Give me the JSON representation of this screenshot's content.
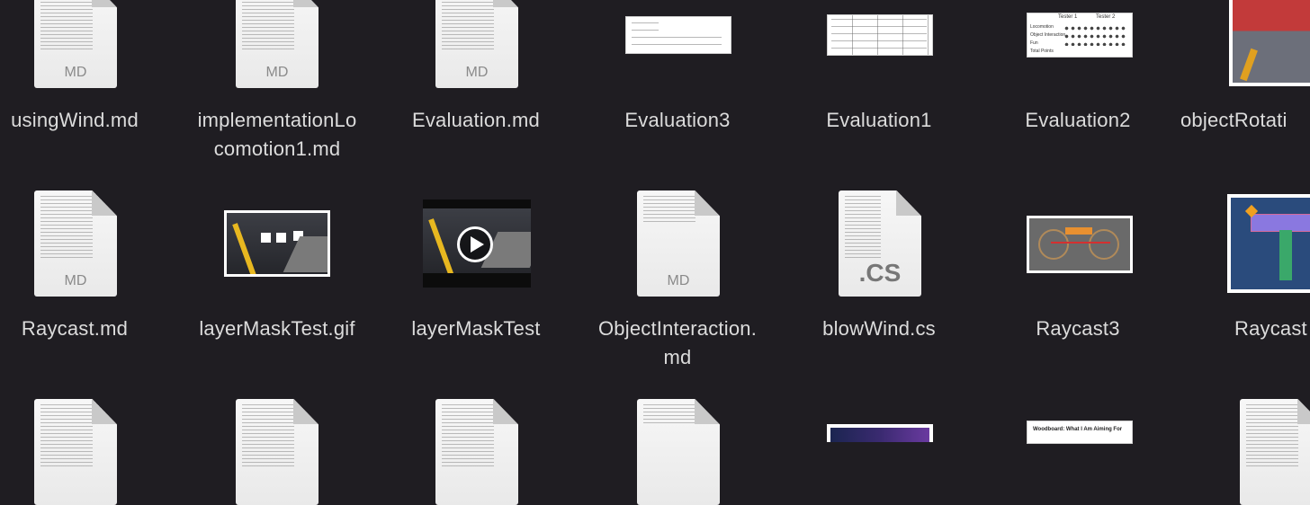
{
  "files": {
    "r1": {
      "f1": {
        "name": "usingWind.md",
        "ext": "MD",
        "icon": "markdown-file-icon"
      },
      "f2": {
        "name_l1": "implementationLo",
        "name_l2": "comotion1.md",
        "ext": "MD",
        "icon": "markdown-file-icon"
      },
      "f3": {
        "name": "Evaluation.md",
        "ext": "MD",
        "icon": "markdown-file-icon"
      },
      "f4": {
        "name": "Evaluation3",
        "icon": "image-thumbnail"
      },
      "f5": {
        "name": "Evaluation1",
        "icon": "image-thumbnail"
      },
      "f6": {
        "name": "Evaluation2",
        "icon": "image-thumbnail"
      },
      "f7": {
        "name": "objectRotati",
        "icon": "image-thumbnail"
      }
    },
    "r2": {
      "f1": {
        "name": "Raycast.md",
        "ext": "MD",
        "icon": "markdown-file-icon"
      },
      "f2": {
        "name": "layerMaskTest.gif",
        "icon": "gif-thumbnail"
      },
      "f3": {
        "name": "layerMaskTest",
        "icon": "video-thumbnail"
      },
      "f4": {
        "name_l1": "ObjectInteraction.",
        "name_l2": "md",
        "ext": "MD",
        "icon": "markdown-file-icon"
      },
      "f5": {
        "name": "blowWind.cs",
        "ext": ".CS",
        "icon": "csharp-file-icon"
      },
      "f6": {
        "name": "Raycast3",
        "icon": "image-thumbnail"
      },
      "f7": {
        "name": "Raycast",
        "icon": "image-thumbnail"
      }
    }
  },
  "thumb_text": {
    "eval2_col1": "Tester 1",
    "eval2_col2": "Tester 2",
    "eval2_row1": "Locomotion",
    "eval2_row2": "Object Interaction",
    "eval2_row3": "Fun",
    "eval2_row4": "Total Points",
    "eval3_title": "Woodboard: What I Am Aiming For"
  },
  "colors": {
    "background": "#1f1d22",
    "label": "#dcdcdc"
  }
}
